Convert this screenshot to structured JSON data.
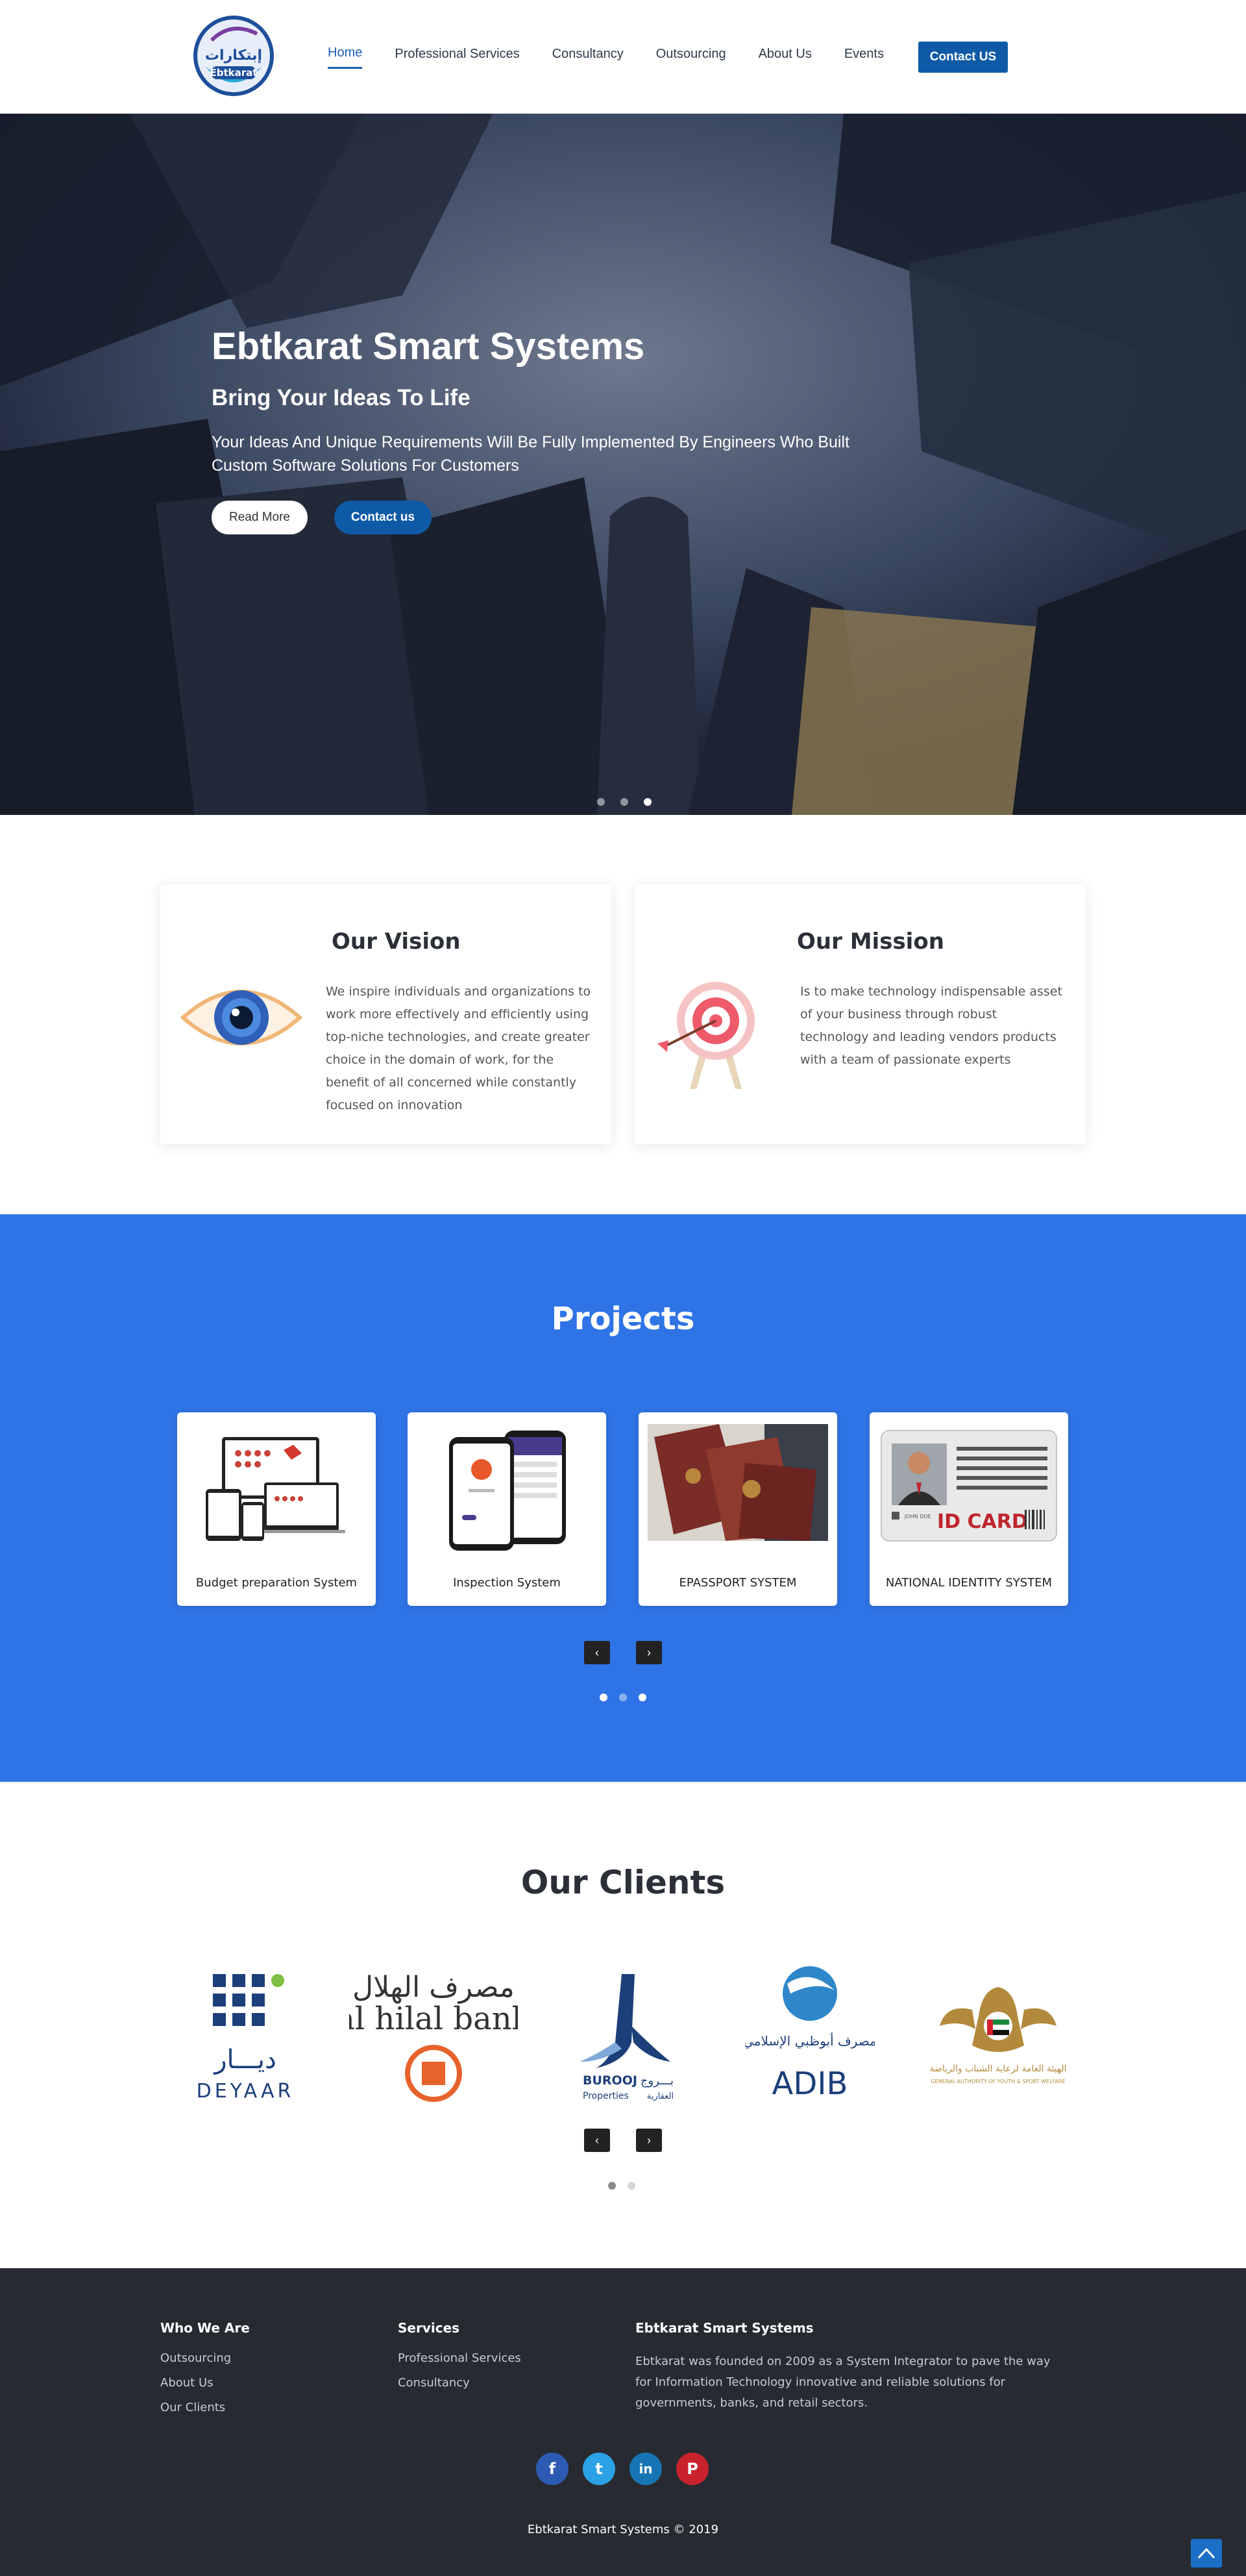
{
  "nav": {
    "logo_ar": "إبتكارات",
    "logo_en": "Ebtkarat",
    "links": [
      {
        "label": "Home"
      },
      {
        "label": "Professional Services"
      },
      {
        "label": "Consultancy"
      },
      {
        "label": "Outsourcing"
      },
      {
        "label": "About Us"
      },
      {
        "label": "Events"
      }
    ],
    "cta": "Contact US",
    "active": "Home"
  },
  "hero": {
    "title": "Ebtkarat Smart Systems",
    "subtitle": "Bring Your Ideas To Life",
    "description": "Your Ideas And Unique Requirements Will Be Fully Implemented By Engineers Who Built Custom Software Solutions For Customers",
    "read_more": "Read More",
    "contact": "Contact us",
    "slides": 3,
    "active_slide": 3
  },
  "vision": {
    "title": "Our Vision",
    "text": "We inspire individuals and organizations to work more effectively and efficiently using top-niche technologies, and create greater choice in the domain of work, for the benefit of all concerned while constantly focused on innovation",
    "icon": "eye-icon"
  },
  "mission": {
    "title": "Our Mission",
    "text": "Is to make technology indispensable asset of your business through robust technology and leading vendors products with a team of passionate experts",
    "icon": "target-icon"
  },
  "projects": {
    "title": "Projects",
    "items": [
      {
        "label": "Budget preparation System",
        "icon": "devices-icon"
      },
      {
        "label": "Inspection System",
        "icon": "phones-icon"
      },
      {
        "label": "EPASSPORT SYSTEM",
        "icon": "passport-icon"
      },
      {
        "label": "NATIONAL IDENTITY SYSTEM",
        "icon": "id-card-icon"
      }
    ],
    "id_card_text": "ID CARD",
    "id_card_name": "JOHN DOE",
    "prev": "‹",
    "next": "›",
    "active_dot": 1
  },
  "clients": {
    "title": "Our Clients",
    "items": [
      {
        "name": "DEYAAR",
        "ar": "ديـــار",
        "color": "#1c3f7a"
      },
      {
        "name": "al hilal bank",
        "ar": "مصرف الهلال",
        "color": "#e8622b"
      },
      {
        "name": "BUROOJ",
        "sub": "Properties",
        "ar": "بـــروج",
        "ar_sub": "العقارية",
        "color": "#1c3f7a"
      },
      {
        "name": "ADIB",
        "ar": "مصرف أبوظبي الإسلامي",
        "color": "#1c3f7a"
      },
      {
        "name": "GENERAL AUTHORITY OF YOUTH & SPORT WELFARE",
        "ar": "الهيئة العامة لرعاية الشباب والرياضة",
        "color": "#b38a3c"
      }
    ],
    "prev": "‹",
    "next": "›",
    "active_dot": 1
  },
  "footer": {
    "who_title": "Who We Are",
    "who_links": [
      "Outsourcing",
      "About Us",
      "Our Clients"
    ],
    "services_title": "Services",
    "services_links": [
      "Professional Services",
      "Consultancy"
    ],
    "about_title": "Ebtkarat Smart Systems",
    "about_text": "Ebtkarat was founded on 2009 as a System Integrator to pave the way for Information Technology innovative and reliable solutions for governments, banks, and retail sectors.",
    "social": [
      {
        "name": "facebook-icon",
        "glyph": "f",
        "color": "#2d5bb4"
      },
      {
        "name": "twitter-icon",
        "glyph": "t",
        "color": "#2ba2e6"
      },
      {
        "name": "linkedin-icon",
        "glyph": "in",
        "color": "#1775b5"
      },
      {
        "name": "pinterest-icon",
        "glyph": "P",
        "color": "#c8232c"
      }
    ],
    "copyright": "Ebtkarat Smart Systems © 2019"
  },
  "colors": {
    "brand": "#0f5aa6",
    "projects_bg": "#2f74e6",
    "footer_bg": "#272b31"
  }
}
